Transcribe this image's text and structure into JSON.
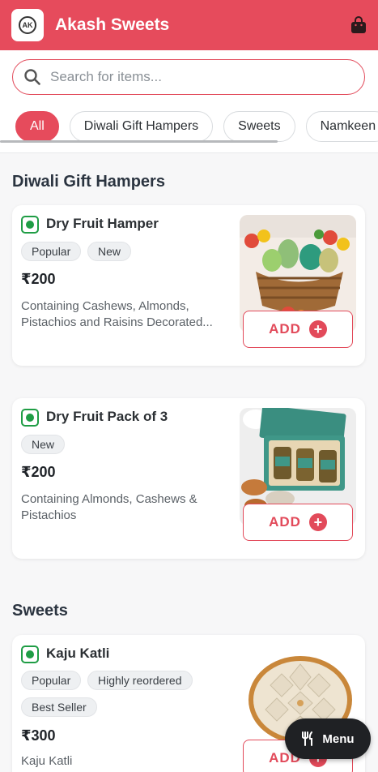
{
  "header": {
    "brand": "Akash Sweets",
    "logo_text": "AK"
  },
  "search": {
    "placeholder": "Search for items..."
  },
  "categories": [
    "All",
    "Diwali Gift Hampers",
    "Sweets",
    "Namkeen"
  ],
  "active_category": "All",
  "sections": [
    {
      "title": "Diwali Gift Hampers",
      "items": [
        {
          "name": "Dry Fruit Hamper",
          "tags": [
            "Popular",
            "New"
          ],
          "price": "₹200",
          "description_line1": "Containing Cashews, Almonds,",
          "description_line2": "Pistachios and Raisins Decorated...",
          "add_label": "ADD"
        },
        {
          "name": "Dry Fruit Pack of 3",
          "tags": [
            "New"
          ],
          "price": "₹200",
          "description_line1": "Containing Almonds, Cashews &",
          "description_line2": "Pistachios",
          "add_label": "ADD"
        }
      ]
    },
    {
      "title": "Sweets",
      "items": [
        {
          "name": "Kaju Katli",
          "tags": [
            "Popular",
            "Highly reordered",
            "Best Seller"
          ],
          "price": "₹300",
          "description_line1": "Kaju Katli",
          "add_label": "ADD"
        }
      ]
    }
  ],
  "menu_button": {
    "label": "Menu"
  },
  "colors": {
    "brand": "#e64b5c",
    "veg": "#1f9d45"
  }
}
